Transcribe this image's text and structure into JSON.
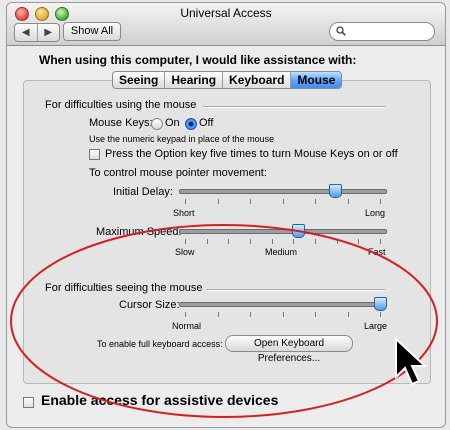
{
  "window": {
    "title": "Universal Access"
  },
  "toolbar": {
    "show_all": "Show All",
    "back_icon": "chevron-left-icon",
    "forward_icon": "chevron-right-icon"
  },
  "search": {
    "placeholder": ""
  },
  "heading": "When using this computer, I would like assistance with:",
  "tabs": [
    {
      "label": "Seeing"
    },
    {
      "label": "Hearing"
    },
    {
      "label": "Keyboard"
    },
    {
      "label": "Mouse",
      "active": true
    }
  ],
  "mouse": {
    "section_title": "For difficulties using the mouse",
    "mouse_keys_label": "Mouse Keys:",
    "on_label": "On",
    "off_label": "Off",
    "mouse_keys_value": "Off",
    "keypad_note": "Use the numeric keypad in place of the mouse",
    "option_key_label": "Press the Option key five times to turn Mouse Keys on or off",
    "option_key_checked": false,
    "pointer_title": "To control mouse pointer movement:",
    "initial_delay": {
      "label": "Initial Delay:",
      "min": "Short",
      "max": "Long",
      "value": 0.77,
      "ticks": 7
    },
    "max_speed": {
      "label": "Maximum Speed:",
      "min": "Slow",
      "mid": "Medium",
      "max": "Fast",
      "value": 0.58,
      "ticks": 10
    }
  },
  "seeing": {
    "section_title": "For difficulties seeing the mouse",
    "cursor_size": {
      "label": "Cursor Size:",
      "min": "Normal",
      "max": "Large",
      "value": 1.0,
      "ticks": 7
    },
    "keyboard_access_label": "To enable full keyboard access:",
    "keyboard_prefs_button": "Open Keyboard Preferences..."
  },
  "assistive": {
    "label": "Enable access for assistive devices",
    "checked": false
  },
  "colors": {
    "accent": "#3d8ff2",
    "annotation": "#d42020"
  }
}
